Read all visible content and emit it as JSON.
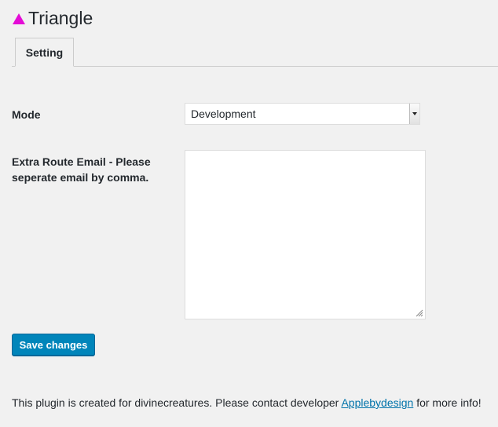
{
  "header": {
    "icon": "triangle-icon",
    "icon_color": "#e40bd6",
    "title": "Triangle"
  },
  "tabs": [
    {
      "label": "Setting",
      "active": true
    }
  ],
  "form": {
    "mode": {
      "label": "Mode",
      "selected": "Development"
    },
    "extra_route_email": {
      "label": "Extra Route Email - Please seperate email by comma.",
      "value": ""
    },
    "save_label": "Save changes"
  },
  "footer": {
    "text_before": "This plugin is created for divinecreatures. Please contact developer ",
    "link_text": "Applebydesign",
    "text_after": " for more info!"
  },
  "colors": {
    "background": "#f1f1f1",
    "primary_button": "#0085ba",
    "link": "#0073aa"
  }
}
